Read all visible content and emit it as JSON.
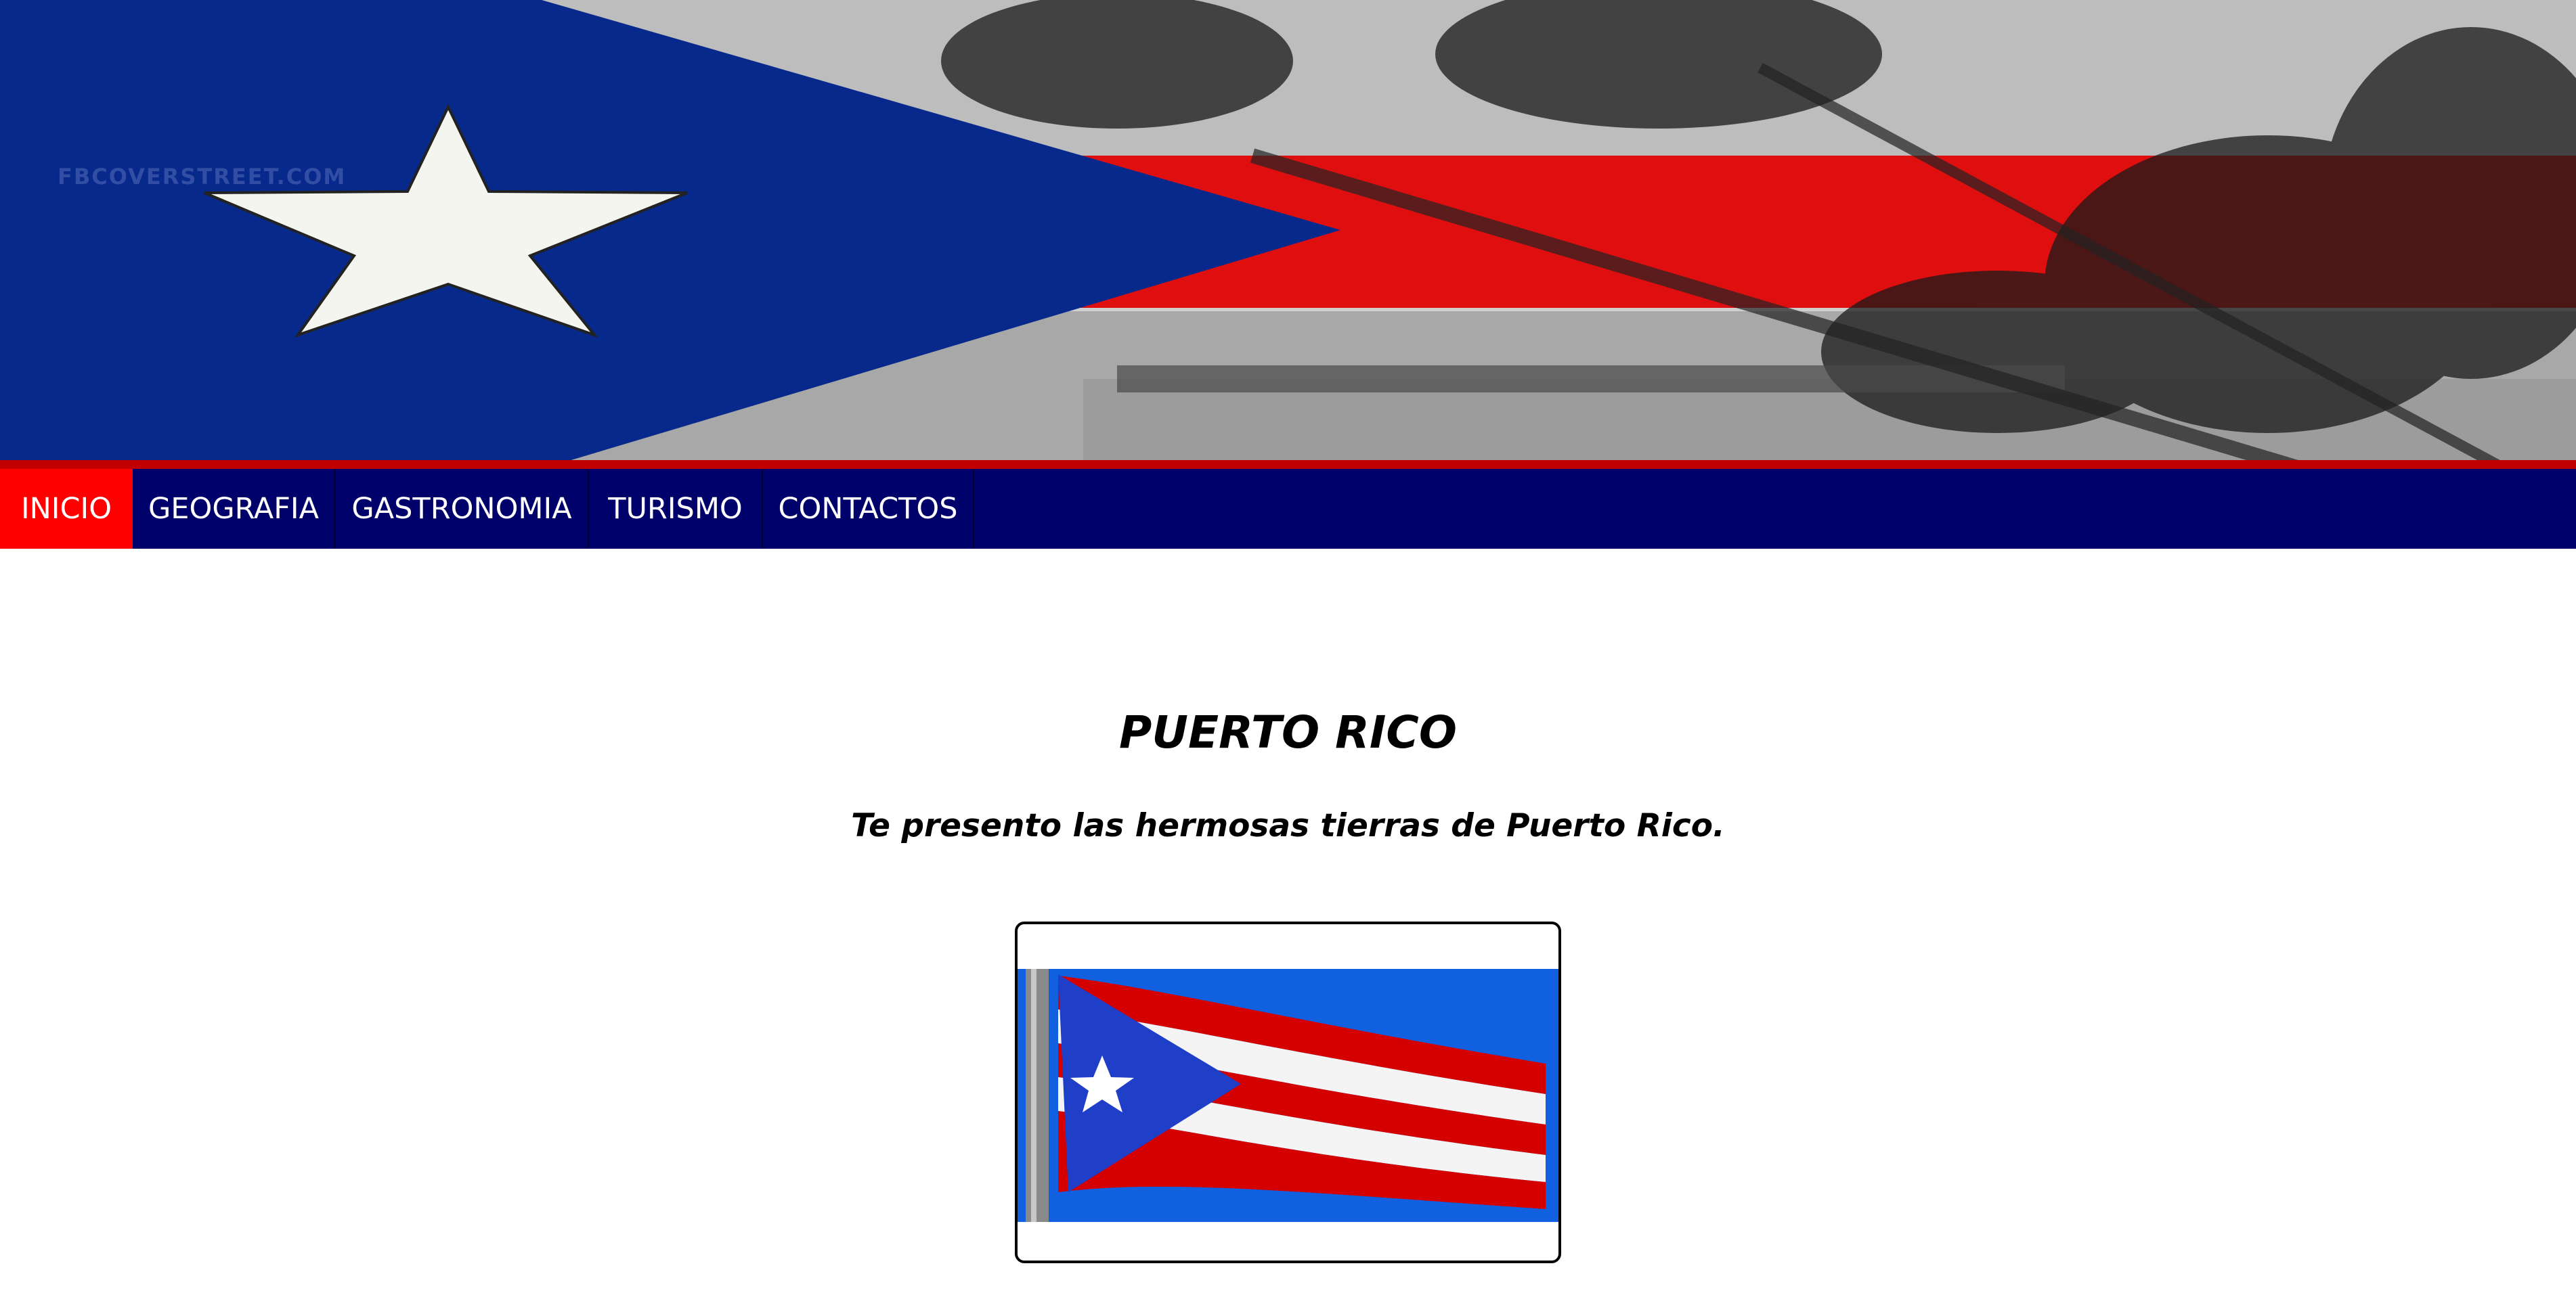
{
  "banner": {
    "watermark": "FBCOVERSTREET.COM",
    "image_description_icon": "puerto-rico-flag-palm-beach-banner"
  },
  "nav": {
    "items": [
      {
        "label": "INICIO",
        "active": true
      },
      {
        "label": "GEOGRAFIA",
        "active": false
      },
      {
        "label": "GASTRONOMIA",
        "active": false
      },
      {
        "label": "TURISMO",
        "active": false
      },
      {
        "label": "CONTACTOS",
        "active": false
      }
    ]
  },
  "main": {
    "title": "PUERTO RICO",
    "subtitle": "Te presento las hermosas tierras de Puerto Rico."
  },
  "colors": {
    "nav_background": "#00006b",
    "nav_active": "#ff0000",
    "flag_blue": "#0a2fa0",
    "flag_red": "#e00000",
    "photo_sky": "#1160e0"
  }
}
